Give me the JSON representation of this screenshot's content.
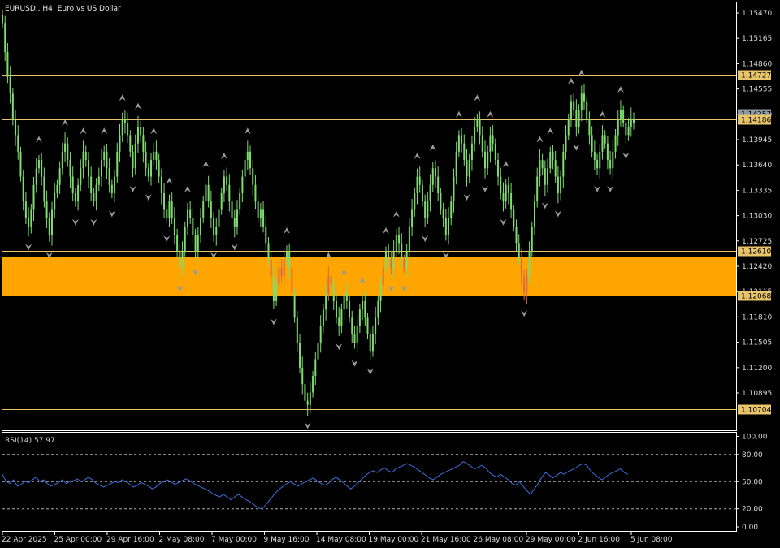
{
  "header": {
    "title": "EURUSD., H4:  Euro vs US Dollar"
  },
  "colors": {
    "background": "#000000",
    "candle": "#7fdc6e",
    "level_line": "#e8c46a",
    "zone_fill": "#ffa500",
    "rsi_line": "#3d6fe0",
    "axis": "#ffffff",
    "fractal": "#9a9a9a"
  },
  "price_axis": {
    "ticks": [
      "1.15470",
      "1.15165",
      "1.14860",
      "1.14555",
      "1.14250",
      "1.13945",
      "1.13640",
      "1.13335",
      "1.13030",
      "1.12725",
      "1.12420",
      "1.12115",
      "1.11810",
      "1.11505",
      "1.11200",
      "1.10895"
    ],
    "tick_values": [
      1.1547,
      1.15165,
      1.1486,
      1.14555,
      1.1425,
      1.13945,
      1.1364,
      1.13335,
      1.1303,
      1.12725,
      1.1242,
      1.12115,
      1.1181,
      1.11505,
      1.112,
      1.10895
    ]
  },
  "levels": [
    {
      "label": "1.14727",
      "value": 1.14727,
      "color": "#e8c46a",
      "text_color": "#000000"
    },
    {
      "label": "1.14257",
      "value": 1.14257,
      "color": "#8c9aa8",
      "text_color": "#000000"
    },
    {
      "label": "1.14186",
      "value": 1.14186,
      "color": "#e8c46a",
      "text_color": "#000000"
    },
    {
      "label": "1.12610",
      "value": 1.1261,
      "color": "#e8c46a",
      "text_color": "#000000"
    },
    {
      "label": "1.12068",
      "value": 1.12068,
      "color": "#e8c46a",
      "text_color": "#000000"
    },
    {
      "label": "1.10704",
      "value": 1.10704,
      "color": "#e8c46a",
      "text_color": "#000000"
    }
  ],
  "zone": {
    "top": 1.1253,
    "bottom": 1.12068
  },
  "rsi": {
    "label": "RSI(14) 57.97",
    "ticks": [
      "100.00",
      "80.00",
      "50.00",
      "20.00",
      "0.00"
    ],
    "tick_values": [
      100,
      80,
      50,
      20,
      0
    ],
    "dashed_levels": [
      80,
      50,
      20
    ],
    "values": [
      58,
      50,
      48,
      52,
      45,
      47,
      50,
      49,
      52,
      55,
      50,
      52,
      48,
      45,
      47,
      49,
      52,
      48,
      50,
      51,
      53,
      50,
      52,
      55,
      52,
      48,
      46,
      44,
      46,
      48,
      50,
      49,
      52,
      50,
      47,
      44,
      46,
      49,
      47,
      45,
      42,
      44,
      48,
      50,
      52,
      50,
      47,
      49,
      51,
      53,
      51,
      48,
      46,
      44,
      42,
      40,
      37,
      35,
      33,
      36,
      33,
      30,
      33,
      36,
      33,
      30,
      28,
      25,
      22,
      20,
      23,
      28,
      33,
      38,
      42,
      45,
      48,
      50,
      47,
      45,
      48,
      50,
      52,
      54,
      51,
      48,
      46,
      48,
      52,
      55,
      52,
      49,
      45,
      42,
      45,
      49,
      53,
      57,
      60,
      62,
      60,
      63,
      65,
      62,
      60,
      64,
      66,
      68,
      70,
      68,
      66,
      63,
      60,
      57,
      54,
      52,
      55,
      58,
      60,
      62,
      64,
      66,
      68,
      72,
      70,
      67,
      64,
      66,
      68,
      65,
      60,
      57,
      55,
      58,
      55,
      52,
      48,
      46,
      50,
      45,
      40,
      36,
      42,
      48,
      55,
      60,
      57,
      54,
      57,
      60,
      58,
      61,
      63,
      65,
      68,
      70,
      68,
      62,
      58,
      55,
      52,
      55,
      58,
      60,
      62,
      64,
      60,
      58
    ]
  },
  "time_axis": {
    "labels": [
      "22 Apr 2025",
      "25 Apr 00:00",
      "29 Apr 16:00",
      "2 May 08:00",
      "7 May 00:00",
      "9 May 16:00",
      "14 May 08:00",
      "19 May 00:00",
      "21 May 16:00",
      "26 May 08:00",
      "29 May 00:00",
      "2 Jun 16:00",
      "5 Jun 08:00"
    ]
  },
  "chart_data": {
    "type": "candlestick",
    "title": "EURUSD., H4:  Euro vs US Dollar",
    "ylim": [
      1.1059,
      1.1564
    ],
    "closes": [
      1.1535,
      1.15,
      1.147,
      1.145,
      1.142,
      1.14,
      1.138,
      1.135,
      1.132,
      1.13,
      1.129,
      1.131,
      1.134,
      1.136,
      1.137,
      1.135,
      1.132,
      1.13,
      1.128,
      1.131,
      1.133,
      1.134,
      1.136,
      1.138,
      1.139,
      1.137,
      1.135,
      1.133,
      1.132,
      1.134,
      1.136,
      1.138,
      1.137,
      1.135,
      1.133,
      1.132,
      1.134,
      1.135,
      1.137,
      1.138,
      1.136,
      1.134,
      1.133,
      1.135,
      1.138,
      1.14,
      1.142,
      1.1415,
      1.14,
      1.138,
      1.136,
      1.139,
      1.141,
      1.14,
      1.138,
      1.136,
      1.135,
      1.137,
      1.138,
      1.137,
      1.135,
      1.133,
      1.131,
      1.13,
      1.132,
      1.13,
      1.128,
      1.126,
      1.124,
      1.126,
      1.129,
      1.131,
      1.13,
      1.128,
      1.126,
      1.128,
      1.13,
      1.132,
      1.134,
      1.132,
      1.13,
      1.128,
      1.129,
      1.131,
      1.133,
      1.135,
      1.134,
      1.132,
      1.13,
      1.129,
      1.131,
      1.133,
      1.135,
      1.137,
      1.138,
      1.136,
      1.134,
      1.132,
      1.13,
      1.131,
      1.129,
      1.127,
      1.125,
      1.123,
      1.12,
      1.122,
      1.124,
      1.123,
      1.125,
      1.126,
      1.124,
      1.121,
      1.118,
      1.115,
      1.112,
      1.11,
      1.108,
      1.1075,
      1.109,
      1.111,
      1.113,
      1.115,
      1.117,
      1.119,
      1.121,
      1.123,
      1.122,
      1.12,
      1.118,
      1.117,
      1.119,
      1.121,
      1.12,
      1.118,
      1.116,
      1.115,
      1.117,
      1.119,
      1.12,
      1.118,
      1.116,
      1.114,
      1.116,
      1.118,
      1.12,
      1.122,
      1.124,
      1.126,
      1.125,
      1.124,
      1.126,
      1.128,
      1.127,
      1.125,
      1.124,
      1.126,
      1.129,
      1.131,
      1.133,
      1.135,
      1.134,
      1.132,
      1.13,
      1.132,
      1.134,
      1.136,
      1.135,
      1.133,
      1.131,
      1.13,
      1.128,
      1.13,
      1.132,
      1.135,
      1.138,
      1.14,
      1.139,
      1.137,
      1.135,
      1.137,
      1.139,
      1.141,
      1.142,
      1.14,
      1.138,
      1.136,
      1.138,
      1.14,
      1.139,
      1.137,
      1.135,
      1.133,
      1.132,
      1.134,
      1.133,
      1.131,
      1.129,
      1.127,
      1.125,
      1.123,
      1.121,
      1.123,
      1.126,
      1.129,
      1.132,
      1.135,
      1.137,
      1.136,
      1.134,
      1.136,
      1.138,
      1.137,
      1.135,
      1.133,
      1.135,
      1.138,
      1.14,
      1.142,
      1.144,
      1.143,
      1.141,
      1.143,
      1.145,
      1.144,
      1.142,
      1.14,
      1.138,
      1.137,
      1.136,
      1.138,
      1.14,
      1.139,
      1.137,
      1.136,
      1.138,
      1.14,
      1.142,
      1.143,
      1.1415,
      1.14,
      1.141,
      1.142,
      1.1415
    ]
  }
}
